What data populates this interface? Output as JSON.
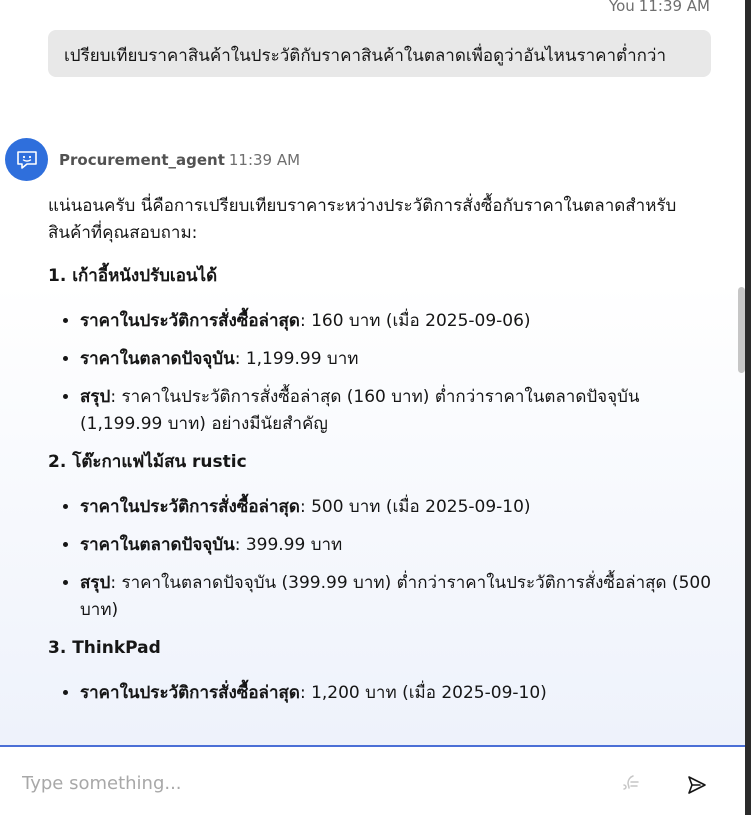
{
  "user_message": {
    "sender": "You",
    "time": "11:39 AM",
    "text": "เปรียบเทียบราคาสินค้าในประวัติกับราคาสินค้าในตลาดเพื่อดูว่าอันไหนราคาต่ำกว่า"
  },
  "agent": {
    "name": "Procurement_agent",
    "time": "11:39 AM",
    "intro": "แน่นอนครับ นี่คือการเปรียบเทียบราคาระหว่างประวัติการสั่งซื้อกับราคาในตลาดสำหรับสินค้าที่คุณสอบถาม:",
    "sections": [
      {
        "title": "1. เก้าอี้หนังปรับเอนได้",
        "items": [
          {
            "key": "ราคาในประวัติการสั่งซื้อล่าสุด",
            "value": ": 160 บาท (เมื่อ 2025-09-06)"
          },
          {
            "key": "ราคาในตลาดปัจจุบัน",
            "value": ": 1,199.99 บาท"
          },
          {
            "key": "สรุป",
            "value": ": ราคาในประวัติการสั่งซื้อล่าสุด (160 บาท) ต่ำกว่าราคาในตลาดปัจจุบัน (1,199.99 บาท) อย่างมีนัยสำคัญ"
          }
        ]
      },
      {
        "title": "2. โต๊ะกาแฟไม้สน rustic",
        "items": [
          {
            "key": "ราคาในประวัติการสั่งซื้อล่าสุด",
            "value": ": 500 บาท (เมื่อ 2025-09-10)"
          },
          {
            "key": "ราคาในตลาดปัจจุบัน",
            "value": ": 399.99 บาท"
          },
          {
            "key": "สรุป",
            "value": ": ราคาในตลาดปัจจุบัน (399.99 บาท) ต่ำกว่าราคาในประวัติการสั่งซื้อล่าสุด (500 บาท)"
          }
        ]
      },
      {
        "title": "3. ThinkPad",
        "items": [
          {
            "key": "ราคาในประวัติการสั่งซื้อล่าสุด",
            "value": ": 1,200 บาท (เมื่อ 2025-09-10)"
          }
        ]
      }
    ]
  },
  "composer": {
    "placeholder": "Type something...",
    "mic_icon": "voice-input-icon",
    "send_icon": "send-icon"
  },
  "colors": {
    "accent": "#2f6fdc",
    "divider": "#4b6fd6",
    "bubble": "#e8e8e8"
  }
}
